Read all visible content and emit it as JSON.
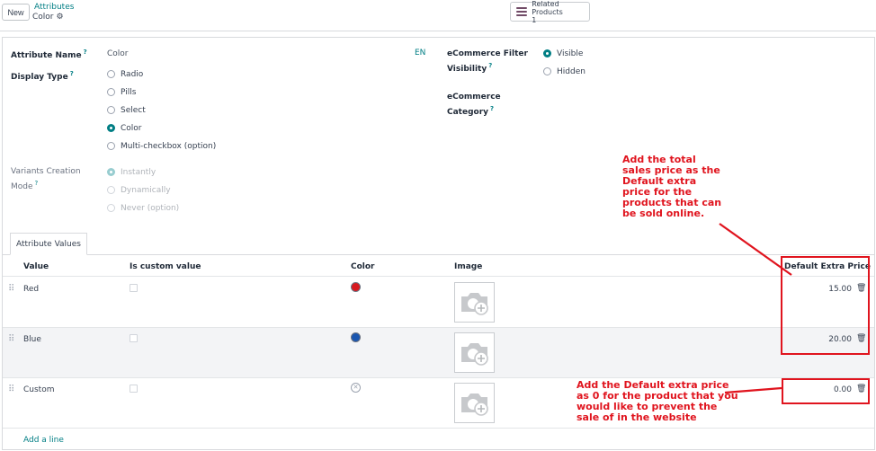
{
  "toolbar": {
    "new_label": "New",
    "breadcrumb_parent": "Attributes",
    "breadcrumb_current": "Color"
  },
  "smart_button": {
    "label": "Related Products",
    "count": "1"
  },
  "form": {
    "attribute_name_label": "Attribute Name",
    "attribute_name_value": "Color",
    "lang_label": "EN",
    "display_type_label": "Display Type",
    "display_type_options": [
      "Radio",
      "Pills",
      "Select",
      "Color",
      "Multi-checkbox (option)"
    ],
    "display_type_selected": "Color",
    "variants_label_1": "Variants Creation",
    "variants_label_2": "Mode",
    "variants_options": [
      "Instantly",
      "Dynamically",
      "Never (option)"
    ],
    "variants_selected": "Instantly",
    "ecom_filter_label_1": "eCommerce Filter",
    "ecom_filter_label_2": "Visibility",
    "ecom_filter_options": [
      "Visible",
      "Hidden"
    ],
    "ecom_filter_selected": "Visible",
    "ecom_category_label_1": "eCommerce",
    "ecom_category_label_2": "Category"
  },
  "tabs": {
    "attribute_values": "Attribute Values"
  },
  "table": {
    "headers": {
      "value": "Value",
      "is_custom": "Is custom value",
      "color": "Color",
      "image": "Image",
      "extra_price": "Default Extra Price"
    },
    "rows": [
      {
        "value": "Red",
        "color": "#d71920",
        "extra_price": "15.00"
      },
      {
        "value": "Blue",
        "color": "#1a56b0",
        "extra_price": "20.00"
      },
      {
        "value": "Custom",
        "color": "",
        "extra_price": "0.00"
      }
    ],
    "add_line": "Add a line"
  },
  "annotations": {
    "top_1": "Add the total",
    "top_2": "sales price as the",
    "top_3": "Default extra",
    "top_4": "price for the",
    "top_5": "products that can",
    "top_6": "be sold online.",
    "bottom_1": "Add the Default extra price",
    "bottom_2": "as 0 for the product that you",
    "bottom_3": "would like to prevent the",
    "bottom_4": "sale of in the website"
  },
  "colors": {
    "accent": "#017e84",
    "brand": "#714b67",
    "annotation": "#e0141e"
  }
}
